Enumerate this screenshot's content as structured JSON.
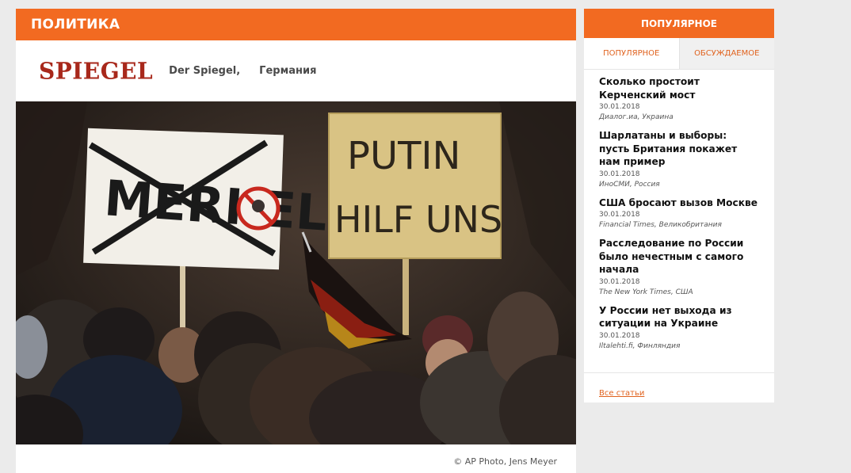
{
  "main": {
    "section_title": "ПОЛИТИКА",
    "source_logo": "SPIEGEL",
    "source_name": "Der Spiegel,",
    "source_country": "Германия",
    "photo": {
      "sign_left": "MERKEL",
      "sign_right_line1": "PUTIN",
      "sign_right_line2": "HILF UNS"
    },
    "photo_credit": "© AP Photo, Jens Meyer"
  },
  "sidebar": {
    "title": "ПОПУЛЯРНОЕ",
    "tabs": [
      {
        "label": "ПОПУЛЯРНОЕ",
        "active": true
      },
      {
        "label": "ОБСУЖДАЕМОЕ",
        "active": false
      }
    ],
    "items": [
      {
        "title": "Сколько простоит Керченский мост",
        "date": "30.01.2018",
        "source": "Диалог.иа, Украина"
      },
      {
        "title": "Шарлатаны и выборы: пусть Британия покажет нам пример",
        "date": "30.01.2018",
        "source": "ИноСМИ, Россия"
      },
      {
        "title": "США бросают вызов Москве",
        "date": "30.01.2018",
        "source": "Financial Times, Великобритания"
      },
      {
        "title": "Расследование по России было нечестным с самого начала",
        "date": "30.01.2018",
        "source": "The New York Times, США"
      },
      {
        "title": "У России нет выхода из ситуации на Украине",
        "date": "30.01.2018",
        "source": "Iltalehti.fi, Финляндия"
      }
    ],
    "all_articles": "Все статьи"
  },
  "colors": {
    "accent": "#f26a21",
    "logo": "#a8281b",
    "background": "#ebebeb"
  }
}
